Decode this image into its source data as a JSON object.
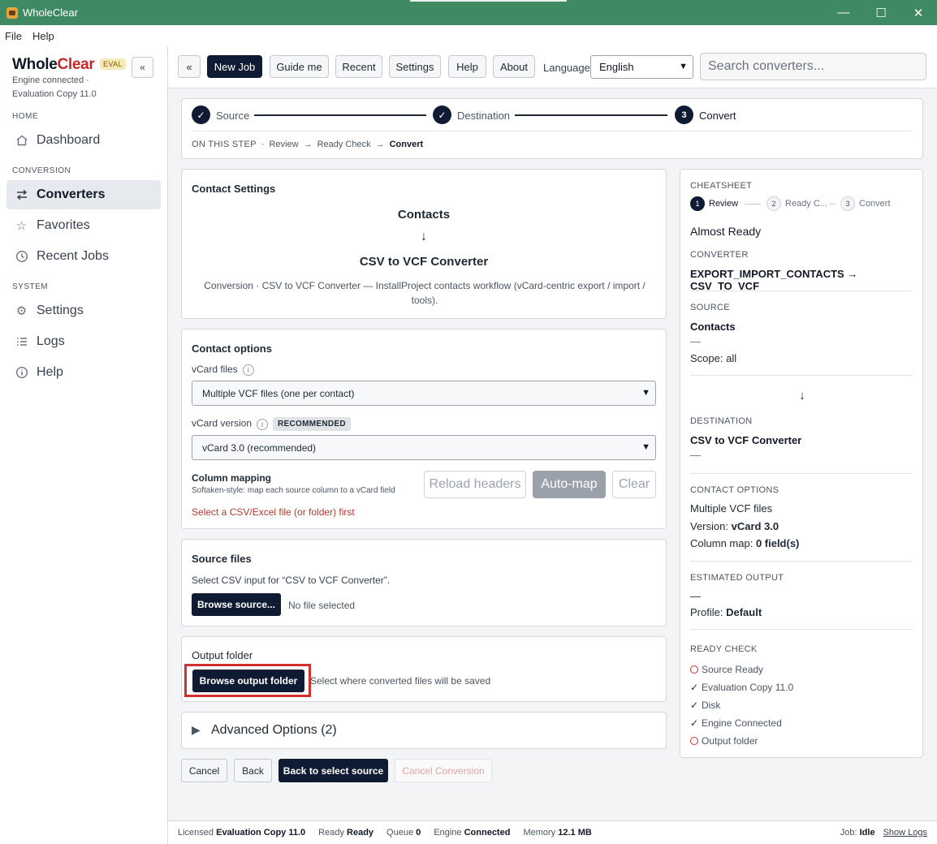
{
  "window": {
    "title": "WholeClear",
    "minimize": "—",
    "maximize": "☐",
    "close": "✕"
  },
  "menu": {
    "items": [
      "File",
      "Help"
    ]
  },
  "sidebar": {
    "brand_part1": "Whole",
    "brand_part2": "Clear",
    "eval_badge": "EVAL",
    "collapse_label": "«",
    "engine_status": "Engine connected ·",
    "edition": "Evaluation Copy 11.0",
    "sections": {
      "home": "HOME",
      "conversion": "CONVERSION",
      "system": "SYSTEM"
    },
    "items": [
      {
        "label": "Dashboard",
        "icon": "home-icon"
      },
      {
        "label": "Converters",
        "icon": "swap-arrows-icon",
        "active": true
      },
      {
        "label": "Favorites",
        "icon": "star-icon"
      },
      {
        "label": "Recent Jobs",
        "icon": "clock-icon"
      },
      {
        "label": "Settings",
        "icon": "gear-icon"
      },
      {
        "label": "Logs",
        "icon": "list-icon"
      },
      {
        "label": "Help",
        "icon": "info-icon"
      }
    ]
  },
  "toolbar": {
    "back": "«",
    "new_job": "New Job",
    "guide": "Guide me",
    "recent": "Recent",
    "settings": "Settings",
    "help": "Help",
    "about": "About",
    "language_label": "Language",
    "language_value": "English",
    "search_placeholder": "Search converters..."
  },
  "stepper": {
    "steps": [
      {
        "label": "Source",
        "state": "done",
        "mark": "✓"
      },
      {
        "label": "Destination",
        "state": "done",
        "mark": "✓"
      },
      {
        "label": "Convert",
        "state": "current",
        "mark": "3"
      }
    ],
    "on_this_step": "ON THIS STEP",
    "sep": "·",
    "arrow": "→",
    "crumbs": [
      "Review",
      "Ready Check",
      "Convert"
    ]
  },
  "contact_settings": {
    "title": "Contact Settings",
    "source": "Contacts",
    "arrow": "↓",
    "converter": "CSV to VCF Converter",
    "description": "Conversion · CSV to VCF Converter — InstallProject contacts workflow (vCard-centric export / import / tools)."
  },
  "contact_options": {
    "title": "Contact options",
    "vcard_files_label": "vCard files",
    "vcard_files_value": "Multiple VCF files (one per contact)",
    "vcard_version_label": "vCard version",
    "recommended_badge": "RECOMMENDED",
    "vcard_version_value": "vCard 3.0 (recommended)",
    "column_mapping_title": "Column mapping",
    "column_mapping_hint": "Softaken-style: map each source column to a vCard field",
    "reload_headers": "Reload headers",
    "auto_map": "Auto-map",
    "clear": "Clear",
    "warning": "Select a CSV/Excel file (or folder) first"
  },
  "source_files": {
    "title": "Source files",
    "hint": "Select CSV input for “CSV to VCF Converter”.",
    "browse": "Browse source...",
    "status": "No file selected"
  },
  "output_folder": {
    "title": "Output folder",
    "browse": "Browse output folder",
    "hint": "Select where converted files will be saved"
  },
  "advanced": {
    "arrow": "▶",
    "label": "Advanced Options (2)"
  },
  "bottom_buttons": {
    "cancel": "Cancel",
    "back": "Back",
    "back_to_source": "Back to select source",
    "cancel_conversion": "Cancel Conversion"
  },
  "cheatsheet": {
    "title": "CHEATSHEET",
    "steps": [
      {
        "num": "1",
        "label": "Review",
        "active": true
      },
      {
        "num": "2",
        "label": "Ready C..."
      },
      {
        "num": "3",
        "label": "Convert"
      }
    ],
    "status": "Almost Ready",
    "converter_head": "CONVERTER",
    "converter_value": "EXPORT_IMPORT_CONTACTS → CSV_TO_VCF",
    "source_head": "SOURCE",
    "source_value": "Contacts",
    "source_dash": "—",
    "scope": "Scope: all",
    "arrow": "↓",
    "destination_head": "DESTINATION",
    "destination_value": "CSV to VCF Converter",
    "destination_dash": "—",
    "contact_options_head": "CONTACT OPTIONS",
    "contact_files": "Multiple VCF files",
    "version_label": "Version:",
    "version_value": "vCard 3.0",
    "colmap_label": "Column map:",
    "colmap_value": "0 field(s)",
    "estimated_head": "ESTIMATED OUTPUT",
    "estimated_dash": "—",
    "profile_label": "Profile:",
    "profile_value": "Default",
    "ready_check_head": "READY CHECK",
    "ready_items": [
      {
        "label": "Source Ready",
        "ok": false
      },
      {
        "label": "Evaluation Copy 11.0",
        "ok": true
      },
      {
        "label": "Disk",
        "ok": true
      },
      {
        "label": "Engine Connected",
        "ok": true
      },
      {
        "label": "Output folder",
        "ok": false
      }
    ]
  },
  "statusbar": {
    "licensed_label": "Licensed",
    "licensed_value": "Evaluation Copy 11.0",
    "ready_label": "Ready",
    "ready_value": "Ready",
    "queue_label": "Queue",
    "queue_value": "0",
    "engine_label": "Engine",
    "engine_value": "Connected",
    "memory_label": "Memory",
    "memory_value": "12.1 MB",
    "job_label": "Job:",
    "job_value": "Idle",
    "show_logs": "Show Logs"
  },
  "colors": {
    "titlebar": "#3f8a63",
    "primary": "#0f1b33",
    "brand_red": "#c62828",
    "highlight": "#d32f2f",
    "warning": "#b23b2e"
  }
}
